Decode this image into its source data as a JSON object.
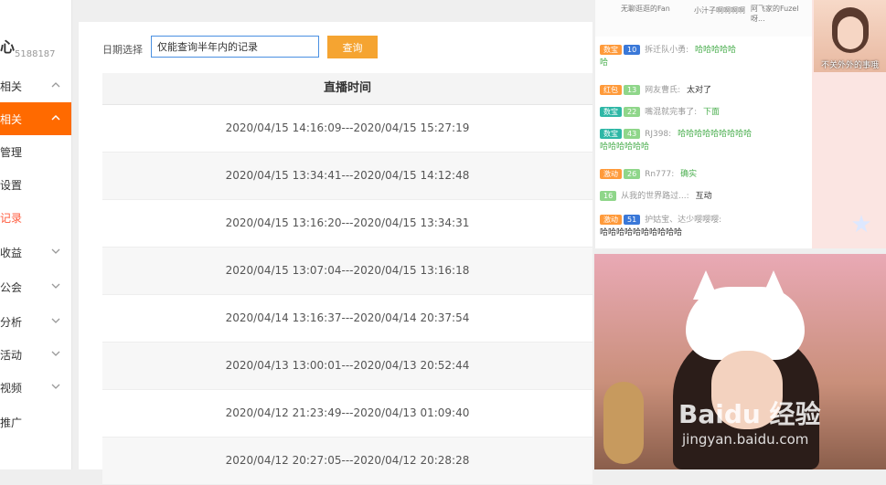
{
  "sidebar": {
    "title": "心",
    "user_id": "5188187",
    "items": [
      {
        "label": "相关",
        "top": 0
      },
      {
        "label": "相关"
      },
      {
        "label": "管理"
      },
      {
        "label": "设置"
      },
      {
        "label": "记录"
      },
      {
        "label": "收益"
      },
      {
        "label": "公会"
      },
      {
        "label": "分析"
      },
      {
        "label": "活动"
      },
      {
        "label": "视频"
      },
      {
        "label": "推广"
      }
    ]
  },
  "filter": {
    "label": "日期选择",
    "input_value": "仅能查询半年内的记录",
    "button_label": "查询"
  },
  "table": {
    "header": "直播时间",
    "rows": [
      "2020/04/15 14:16:09---2020/04/15 15:27:19",
      "2020/04/15 13:34:41---2020/04/15 14:12:48",
      "2020/04/15 13:16:20---2020/04/15 13:34:31",
      "2020/04/15 13:07:04---2020/04/15 13:16:18",
      "2020/04/14 13:16:37---2020/04/14 20:37:54",
      "2020/04/13 13:00:01---2020/04/13 20:52:44",
      "2020/04/12 21:23:49---2020/04/13 01:09:40",
      "2020/04/12 20:27:05---2020/04/12 20:28:28"
    ]
  },
  "chat": {
    "top_names": [
      "无聊逛逛的Fan",
      "小汁子啊啊啊啊",
      "阿飞家的Fuzel呀..."
    ],
    "messages": [
      {
        "badges": [
          "数宝",
          "10"
        ],
        "nick": "拆迁队小勇:",
        "text": "哈哈哈哈哈",
        "text2": "哈"
      },
      {
        "badges": [
          "红包",
          "13"
        ],
        "nick": "网友曹氏:",
        "text": "太对了"
      },
      {
        "badges": [
          "数宝",
          "22"
        ],
        "nick": "嘴混就完事了:",
        "text": "下面"
      },
      {
        "badges": [
          "数宝",
          "43"
        ],
        "nick": "RJ398:",
        "text": "哈哈哈哈哈哈哈哈哈",
        "text2": "哈哈哈哈哈哈"
      },
      {
        "badges": [
          "激动",
          "26"
        ],
        "nick": "Rn777:",
        "text": "确实"
      },
      {
        "badges": [
          "16"
        ],
        "nick": "从我的世界路过...:",
        "text": "互动"
      },
      {
        "badges": [
          "激动",
          "51"
        ],
        "nick": "护姑宝、达少嘤嘤嘤:",
        "text": "哈哈哈哈哈哈哈哈哈哈"
      }
    ]
  },
  "thumb_caption": "不关外外的事哦",
  "watermark": {
    "brand": "Baidu 经验",
    "url": "jingyan.baidu.com"
  }
}
